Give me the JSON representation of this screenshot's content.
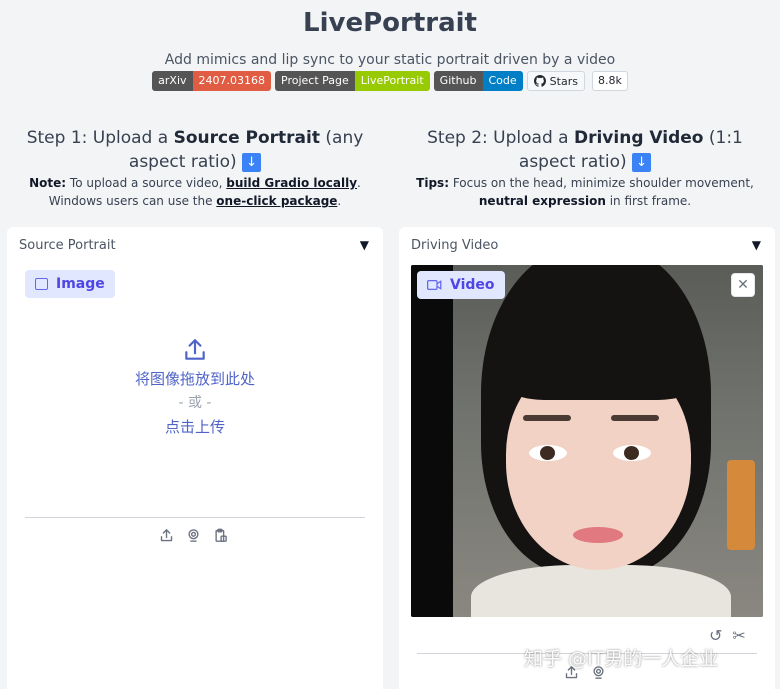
{
  "app": {
    "title": "LivePortrait",
    "subtitle": "Add mimics and lip sync to your static portrait driven by a video"
  },
  "badges": {
    "arxiv_label": "arXiv",
    "arxiv_value": "2407.03168",
    "project_label": "Project Page",
    "project_value": "LivePortrait",
    "github_label": "Github",
    "github_value": "Code",
    "stars_label": "Stars",
    "stars_count": "8.8k"
  },
  "step1": {
    "prefix": "Step 1: Upload a ",
    "bold": "Source Portrait",
    "suffix": " (any aspect ratio) ",
    "arrow": "↓",
    "note_bold": "Note:",
    "note_text1": " To upload a source video, ",
    "note_link1": "build Gradio locally",
    "note_text2": ". Windows users can use the ",
    "note_link2": "one-click package",
    "note_text3": "."
  },
  "step2": {
    "prefix": "Step 2: Upload a ",
    "bold": "Driving Video",
    "suffix": " (1:1 aspect ratio) ",
    "arrow": "↓",
    "tips_bold": "Tips:",
    "tips_text1": " Focus on the head, minimize shoulder movement, ",
    "tips_bold2": "neutral expression",
    "tips_text2": " in first frame."
  },
  "source_panel": {
    "label": "Source Portrait",
    "caret": "▼",
    "chip_label": "Image",
    "upload_arrow": "⇧",
    "drop_text": "将图像拖放到此处",
    "or_text": "- 或 -",
    "click_text": "点击上传",
    "tools": [
      "⇪",
      "◎",
      "⎘"
    ]
  },
  "driving_panel": {
    "label": "Driving Video",
    "caret": "▼",
    "chip_label": "Video",
    "close": "✕",
    "tools_right": [
      "↺",
      "✂"
    ],
    "tools_bottom": [
      "⇪",
      "◎"
    ]
  },
  "watermark": "知乎 @IT男的一人企业",
  "colors": {
    "accent": "#4f46e5",
    "chip_bg": "#e0e7ff",
    "page_bg": "#f3f4f6"
  }
}
